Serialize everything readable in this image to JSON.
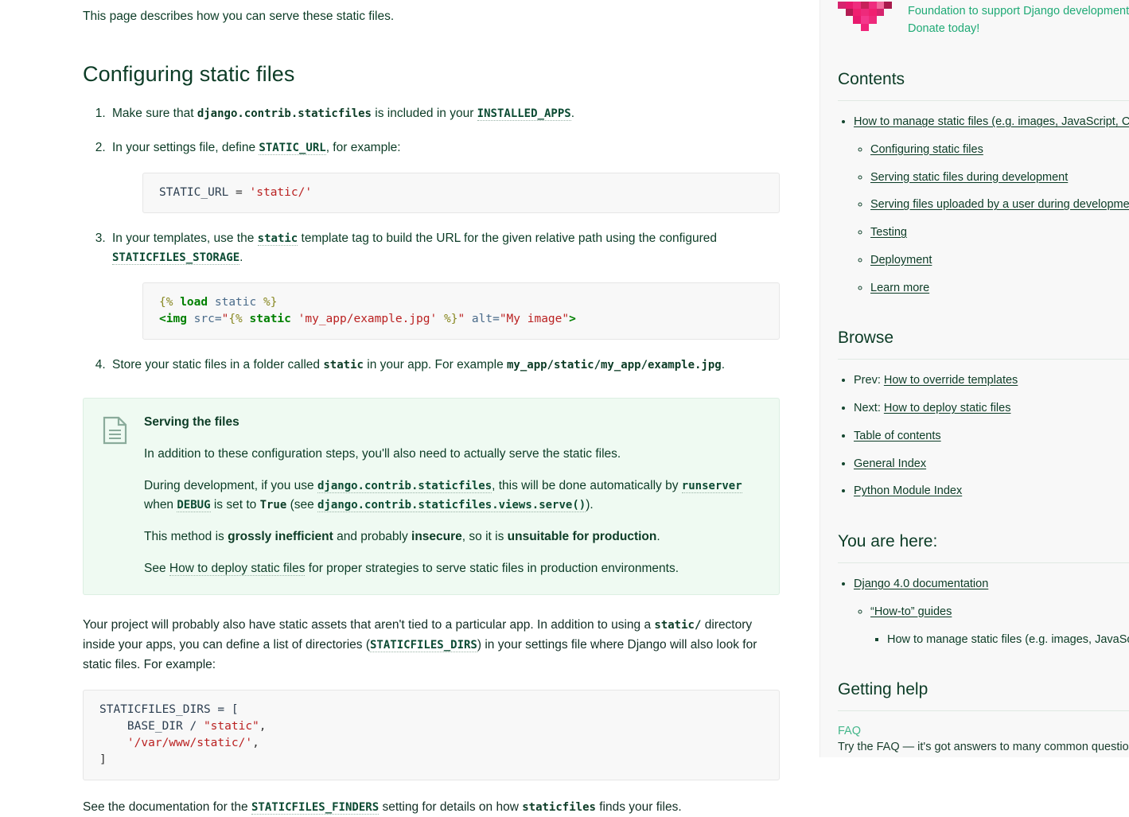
{
  "main": {
    "intro_paragraph": "This page describes how you can serve these static files.",
    "section_title": "Configuring static files",
    "steps": {
      "s1_a": "Make sure that ",
      "s1_code": "django.contrib.staticfiles",
      "s1_b": " is included in your ",
      "s1_link": "INSTALLED_APPS",
      "s1_c": ".",
      "s2_a": "In your settings file, define ",
      "s2_link": "STATIC_URL",
      "s2_b": ", for example:",
      "s3_a": "In your templates, use the ",
      "s3_link1": "static",
      "s3_b": " template tag to build the URL for the given relative path using the configured ",
      "s3_link2": "STATICFILES_STORAGE",
      "s3_c": ".",
      "s4_a": "Store your static files in a folder called ",
      "s4_code1": "static",
      "s4_b": " in your app. For example ",
      "s4_code2": "my_app/static/my_app/example.jpg",
      "s4_c": "."
    },
    "code_static_url": {
      "name": "STATIC_URL",
      "op": " = ",
      "value": "'static/'"
    },
    "code_template": {
      "l1_open": "{%",
      "l1_kw": " load ",
      "l1_var": "static",
      "l1_close": " %}",
      "l2_tag_open": "<img",
      "l2_attr": " src=",
      "l2_quote": "\"",
      "l2_tpl_open": "{%",
      "l2_tpl_kw": " static ",
      "l2_tpl_str": "'my_app/example.jpg'",
      "l2_tpl_close": " %}",
      "l2_quote2": "\"",
      "l2_attr2": " alt=",
      "l2_attrval2": "\"My image\"",
      "l2_tag_close": ">"
    },
    "code_dirs": {
      "l1": "STATICFILES_DIRS = [",
      "l2_indent": "    BASE_DIR / ",
      "l2_str": "\"static\"",
      "l2_end": ",",
      "l3_indent": "    ",
      "l3_str": "'/var/www/static/'",
      "l3_end": ",",
      "l4": "]"
    },
    "admonition": {
      "icon": "document-icon",
      "title": "Serving the files",
      "p1": "In addition to these configuration steps, you'll also need to actually serve the static files.",
      "p2_a": "During development, if you use ",
      "p2_link1": "django.contrib.staticfiles",
      "p2_b": ", this will be done automatically by ",
      "p2_link2": "runserver",
      "p2_c": " when ",
      "p2_link3": "DEBUG",
      "p2_d": " is set to ",
      "p2_code1": "True",
      "p2_e": " (see ",
      "p2_link4": "django.contrib.staticfiles.views.serve()",
      "p2_f": ").",
      "p3_a": "This method is ",
      "p3_b1": "grossly inefficient",
      "p3_c": " and probably ",
      "p3_b2": "insecure",
      "p3_d": ", so it is ",
      "p3_b3": "unsuitable for production",
      "p3_e": ".",
      "p4_a": "See ",
      "p4_link": "How to deploy static files",
      "p4_b": " for proper strategies to serve static files in production environments."
    },
    "para_dirs": {
      "a": "Your project will probably also have static assets that aren't tied to a particular app. In addition to using a ",
      "code1": "static/",
      "b": " directory inside your apps, you can define a list of directories (",
      "link1": "STATICFILES_DIRS",
      "c": ") in your settings file where Django will also look for static files. For example:"
    },
    "para_finders": {
      "a": "See the documentation for the ",
      "link1": "STATICFILES_FINDERS",
      "b": " setting for details on how ",
      "code1": "staticfiles",
      "c": " finds your files."
    }
  },
  "sidebar": {
    "donate": {
      "logo": "django-software-foundation-heart",
      "line1": "Foundation to support Django development.",
      "line2": "Donate today!"
    },
    "contents": {
      "title": "Contents",
      "top_item": "How to manage static files (e.g. images, JavaScript, CSS)",
      "sub_items": [
        "Configuring static files",
        "Serving static files during development",
        "Serving files uploaded by a user during development",
        "Testing",
        "Deployment",
        "Learn more"
      ]
    },
    "browse": {
      "title": "Browse",
      "prev_label": "Prev: ",
      "prev_link": "How to override templates",
      "next_label": "Next: ",
      "next_link": "How to deploy static files",
      "links": [
        "Table of contents",
        "General Index",
        "Python Module Index"
      ]
    },
    "you_are_here": {
      "title": "You are here:",
      "level1": "Django 4.0 documentation",
      "level2": "“How-to” guides",
      "level3": "How to manage static files (e.g. images, JavaScript, CSS)"
    },
    "getting_help": {
      "title": "Getting help",
      "faq_link": "FAQ",
      "faq_desc": "Try the FAQ — it's got answers to many common questions."
    }
  },
  "colors": {
    "accent_green": "#0c4b33",
    "link_teal": "#44b78b",
    "donate_green": "#20aa76",
    "code_string_red": "#ba2121",
    "admonition_bg": "#effaf2",
    "sidebar_bg": "#f8f8f8",
    "heart_pink": "#e91e78"
  }
}
